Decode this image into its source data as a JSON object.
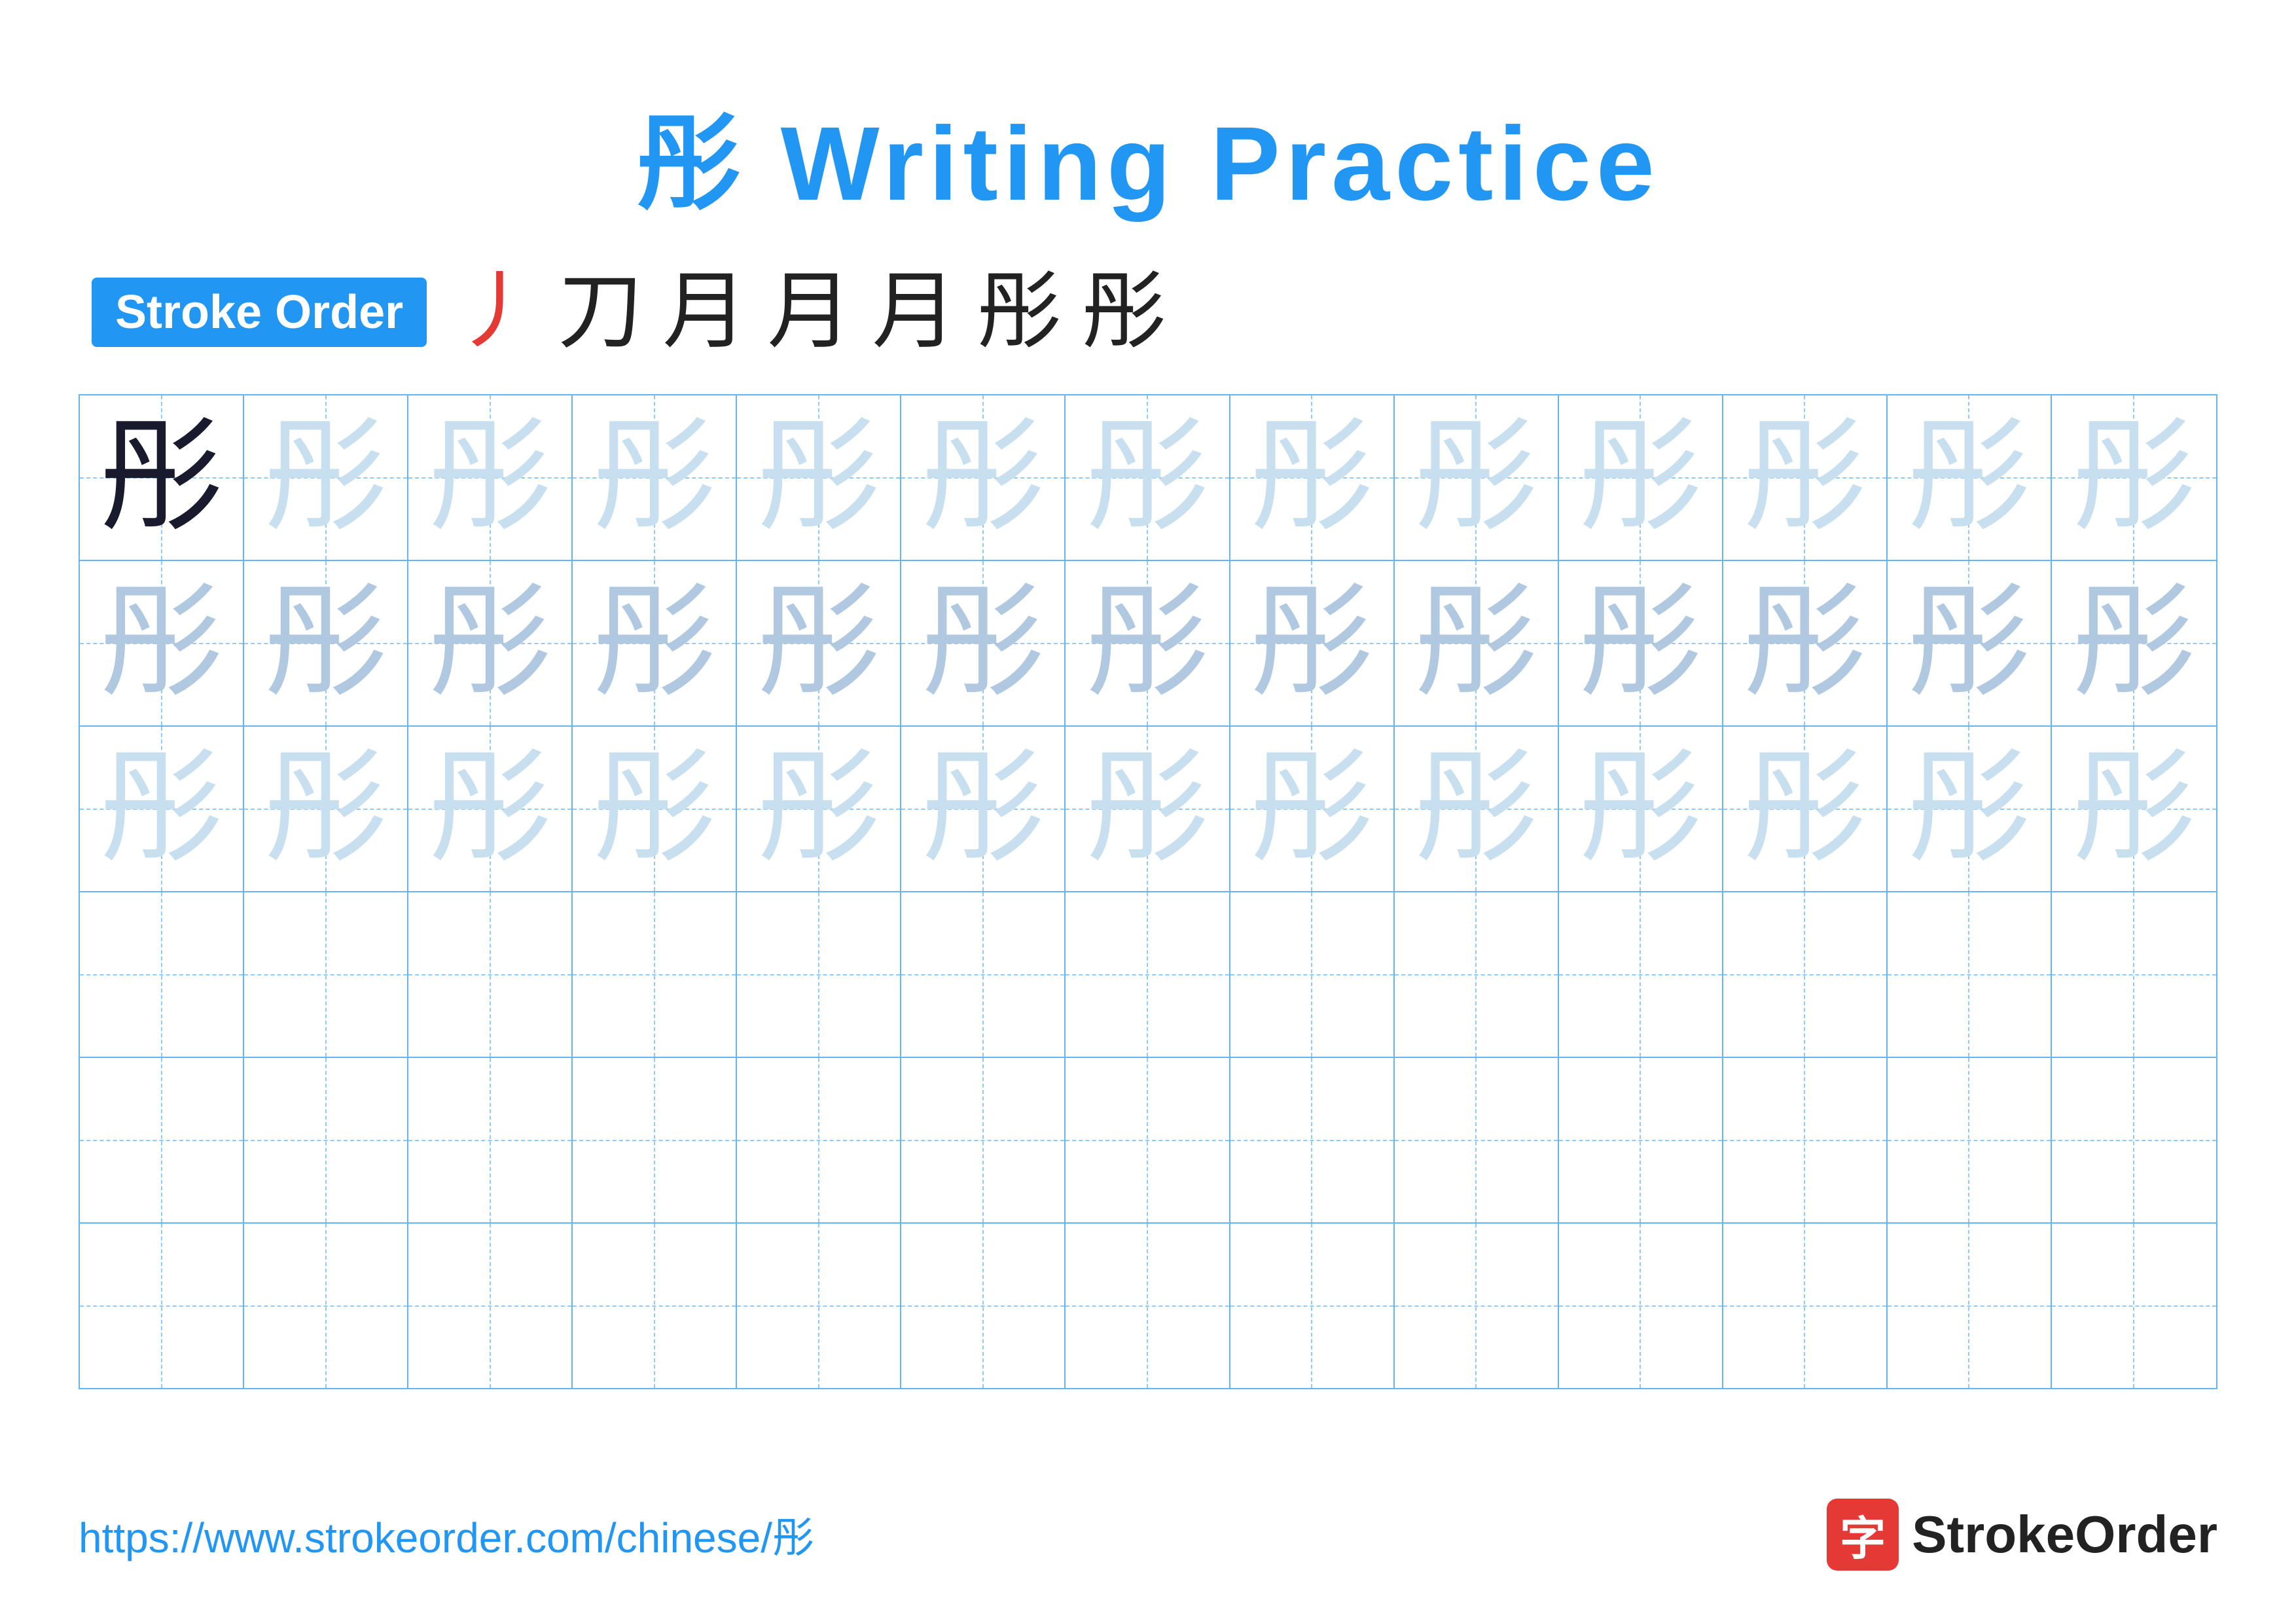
{
  "title": {
    "char": "彤",
    "label": "Writing Practice",
    "full": "彤 Writing Practice"
  },
  "stroke_order": {
    "badge_label": "Stroke Order",
    "strokes": [
      "丿",
      "刀",
      "月",
      "月",
      "月",
      "彤",
      "彤"
    ]
  },
  "grid": {
    "rows": 6,
    "cols": 13,
    "character": "彤",
    "row1_has_dark_first": true
  },
  "footer": {
    "url": "https://www.strokeorder.com/chinese/彤",
    "brand_char": "字",
    "brand_name": "StrokeOrder"
  }
}
